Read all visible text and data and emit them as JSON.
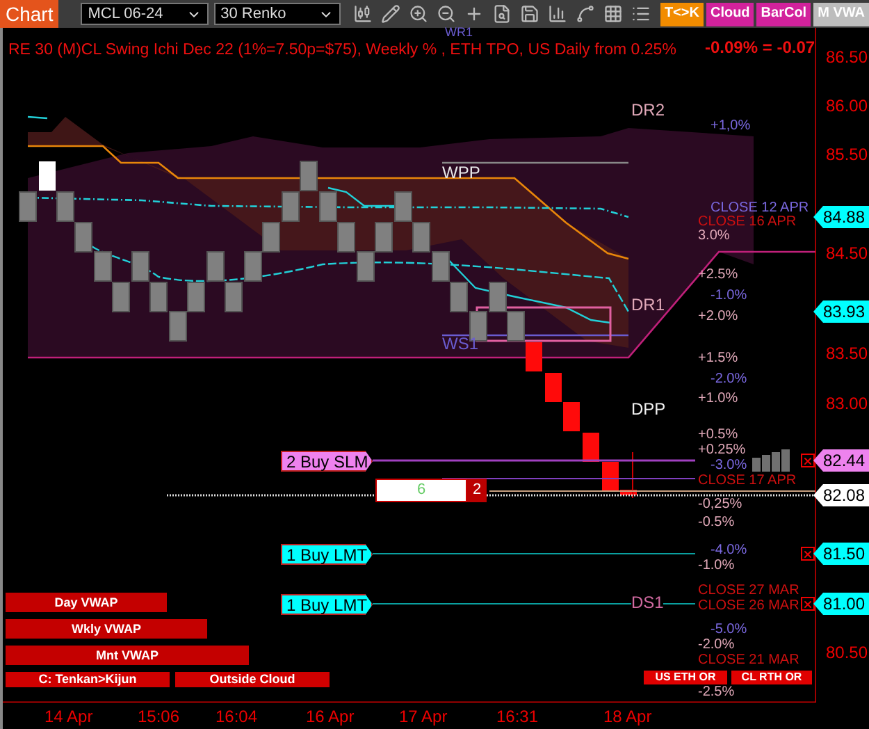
{
  "toolbar": {
    "app_button": "Chart",
    "symbol": "MCL 06-24",
    "bar_type": "30 Renko",
    "toggles": [
      {
        "label": "T<>K",
        "color": "#f28c00"
      },
      {
        "label": "Cloud",
        "color": "#d2229c"
      },
      {
        "label": "BarCol",
        "color": "#d2229c"
      },
      {
        "label": "M VWA",
        "color": "#bdbdbd"
      }
    ]
  },
  "chart": {
    "title": "RE 30 (M)CL Swing Ichi Dec 22  (1%=7.50p=$75), Weekly % , ETH TPO, US Daily from 0.25%",
    "change": "-0.09% = -0.07",
    "pivot_labels": [
      {
        "text": "WR1",
        "color": "#6a5cd0"
      },
      {
        "text": "DR2",
        "color": "#e0a8b8"
      },
      {
        "text": "WPP",
        "color": "#e8e8e8"
      },
      {
        "text": "DR1",
        "color": "#e0a8b8"
      },
      {
        "text": "WS1",
        "color": "#6a5cd0"
      },
      {
        "text": "DPP",
        "color": "#f0f0f0"
      },
      {
        "text": "DS1",
        "color": "#d06aa0"
      }
    ],
    "percent_labels": [
      {
        "text": "+1,0%",
        "color": "#7a68e0"
      },
      {
        "text": "CLOSE 12 APR",
        "color": "#7a68e0"
      },
      {
        "text": "CLOSE 16 APR",
        "color": "#d01010"
      },
      {
        "text": "3.0%",
        "color": "#e0a8b8"
      },
      {
        "text": "+2.5%",
        "color": "#e0a8b8"
      },
      {
        "text": "-1.0%",
        "color": "#7a68e0"
      },
      {
        "text": "+2.0%",
        "color": "#e0a8b8"
      },
      {
        "text": "+1.5%",
        "color": "#e0a8b8"
      },
      {
        "text": "-2.0%",
        "color": "#7a68e0"
      },
      {
        "text": "+1.0%",
        "color": "#e0a8b8"
      },
      {
        "text": "+0.5%",
        "color": "#e0a8b8"
      },
      {
        "text": "+0.25%",
        "color": "#e0a8b8"
      },
      {
        "text": "-3.0%",
        "color": "#7a68e0"
      },
      {
        "text": "CLOSE 17 APR",
        "color": "#d01010"
      },
      {
        "text": "-0,25%",
        "color": "#e0a8b8"
      },
      {
        "text": "-0.5%",
        "color": "#e0a8b8"
      },
      {
        "text": "-4.0%",
        "color": "#7a68e0"
      },
      {
        "text": "-1.0%",
        "color": "#e0a8b8"
      },
      {
        "text": "CLOSE 27 MAR",
        "color": "#d01010"
      },
      {
        "text": "CLOSE 26 MAR",
        "color": "#d01010"
      },
      {
        "text": "-5.0%",
        "color": "#7a68e0"
      },
      {
        "text": "-2.0%",
        "color": "#e0a8b8"
      },
      {
        "text": "CLOSE 21 MAR",
        "color": "#d01010"
      },
      {
        "text": "-2.5%",
        "color": "#e0a8b8"
      }
    ],
    "orders": [
      {
        "label": "2 Buy SLM",
        "color": "#ee82ee"
      },
      {
        "label": "1 Buy LMT",
        "color": "#00ffff"
      },
      {
        "label": "1 Buy LMT",
        "color": "#00ffff"
      }
    ],
    "position": {
      "quantity": "6",
      "count": "2"
    },
    "price_tags": [
      {
        "value": "84.88",
        "color": "#00ffff"
      },
      {
        "value": "83.93",
        "color": "#00ffff"
      },
      {
        "value": "82.44",
        "color": "#ee82ee"
      },
      {
        "value": "82.08",
        "color": "#ffffff"
      },
      {
        "value": "81.50",
        "color": "#00ffff"
      },
      {
        "value": "81.00",
        "color": "#00ffff"
      }
    ],
    "price_axis": [
      "86.50",
      "86.00",
      "85.50",
      "84.50",
      "83.50",
      "83.00",
      "80.50"
    ],
    "time_axis": [
      "14 Apr",
      "15:06",
      "16:04",
      "16 Apr",
      "17 Apr",
      "16:31",
      "18 Apr"
    ],
    "signals": [
      "Day VWAP",
      "Wkly VWAP",
      "Mnt VWAP",
      "C: Tenkan>Kijun",
      "Outside Cloud"
    ],
    "opening_ranges": [
      "US ETH OR",
      "CL RTH OR"
    ]
  }
}
